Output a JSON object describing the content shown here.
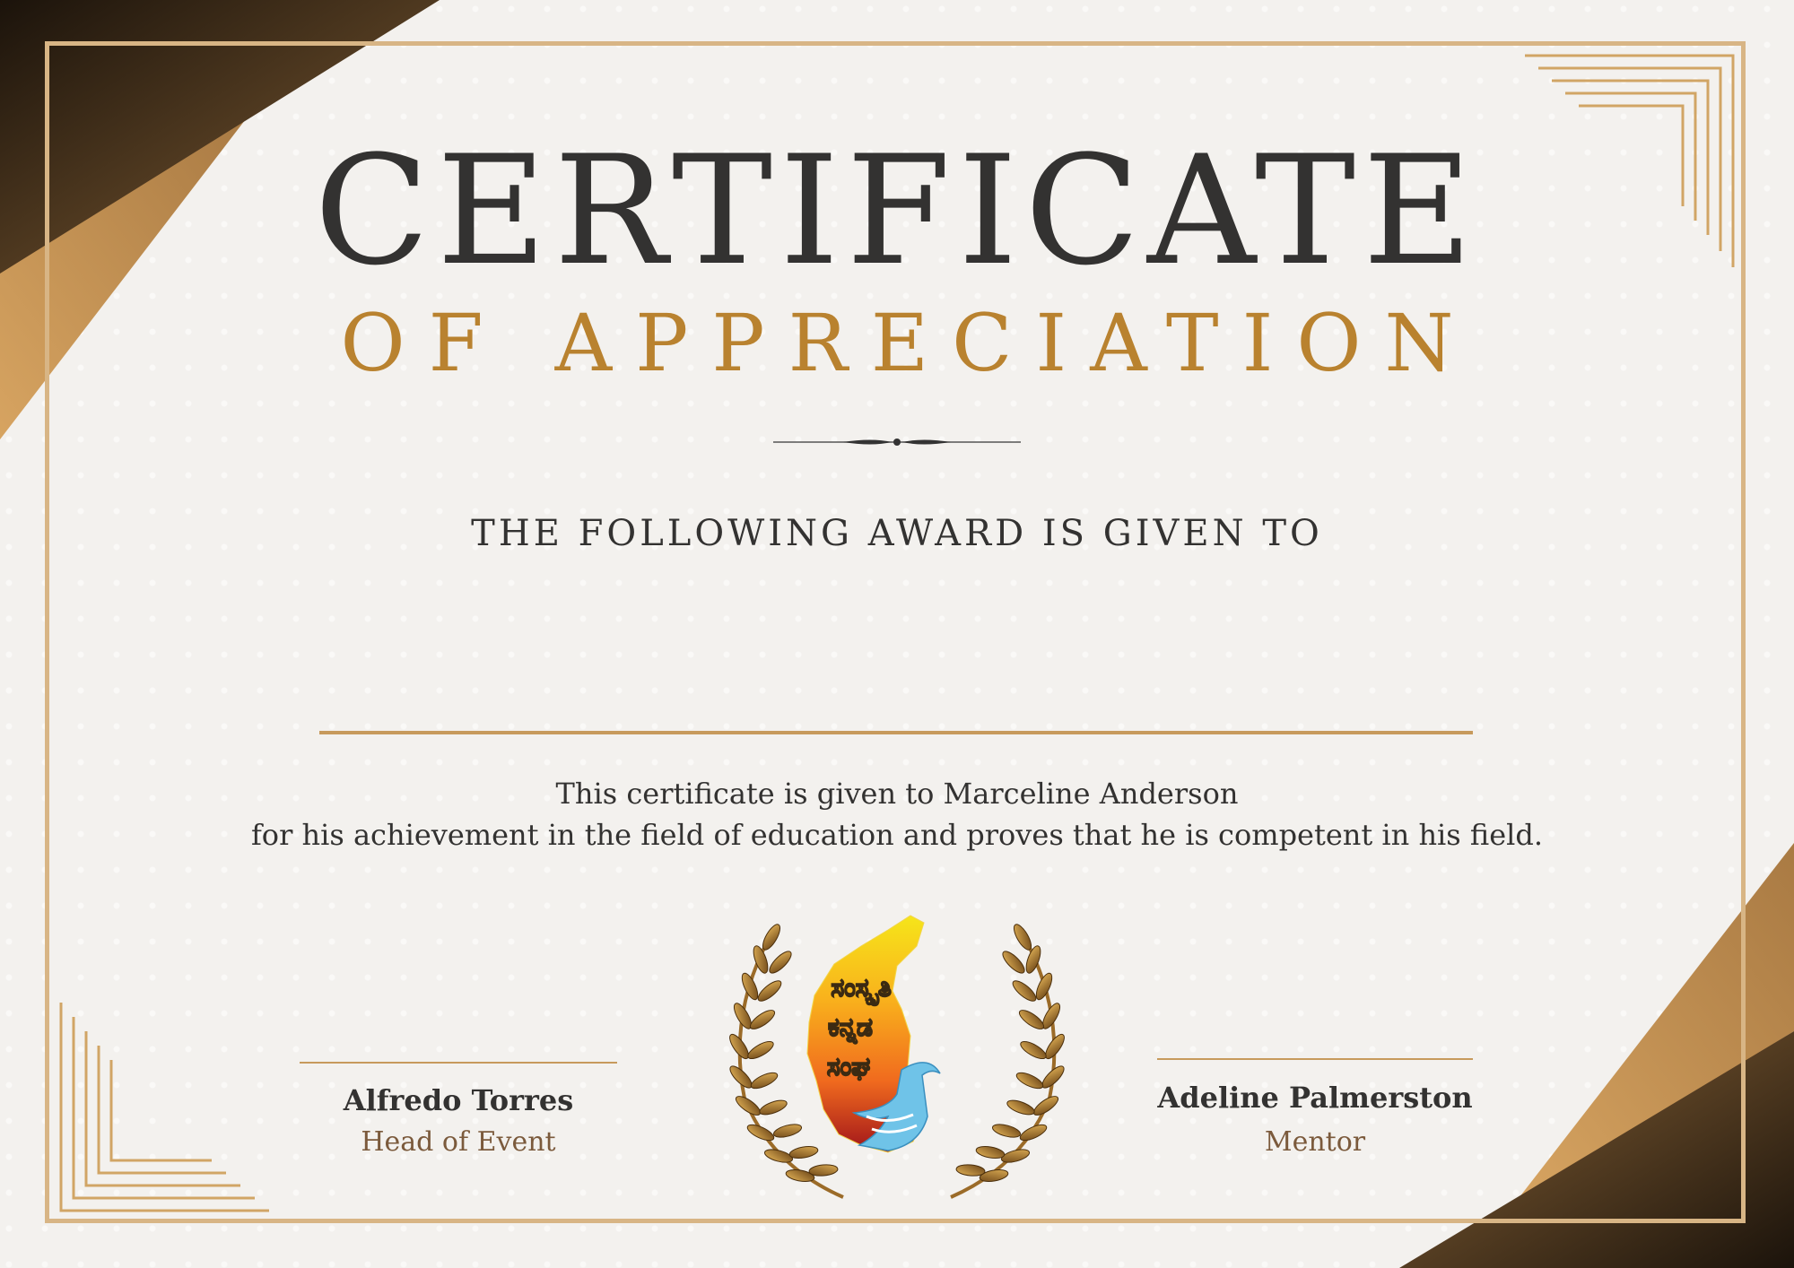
{
  "certificate": {
    "title": "CERTIFICATE",
    "subtitle": "OF APPRECIATION",
    "given_to": "THE FOLLOWING AWARD IS GIVEN TO",
    "description_line1": "This certificate is given to Marceline Anderson",
    "description_line2": "for his achievement in the field of education and proves that he is competent in his field."
  },
  "signatories": [
    {
      "name": "Alfredo Torres",
      "role": "Head of Event"
    },
    {
      "name": "Adeline Palmerston",
      "role": "Mentor"
    }
  ],
  "emblem": {
    "text_line1": "ಸಂಸ್ಕೃತಿ",
    "text_line2": "ಕನ್ನಡ",
    "text_line3": "ಸಂಘ"
  },
  "colors": {
    "background": "#f3f1ee",
    "gold": "#c79a5c",
    "dark_text": "#333231",
    "accent_text": "#b9822f"
  }
}
